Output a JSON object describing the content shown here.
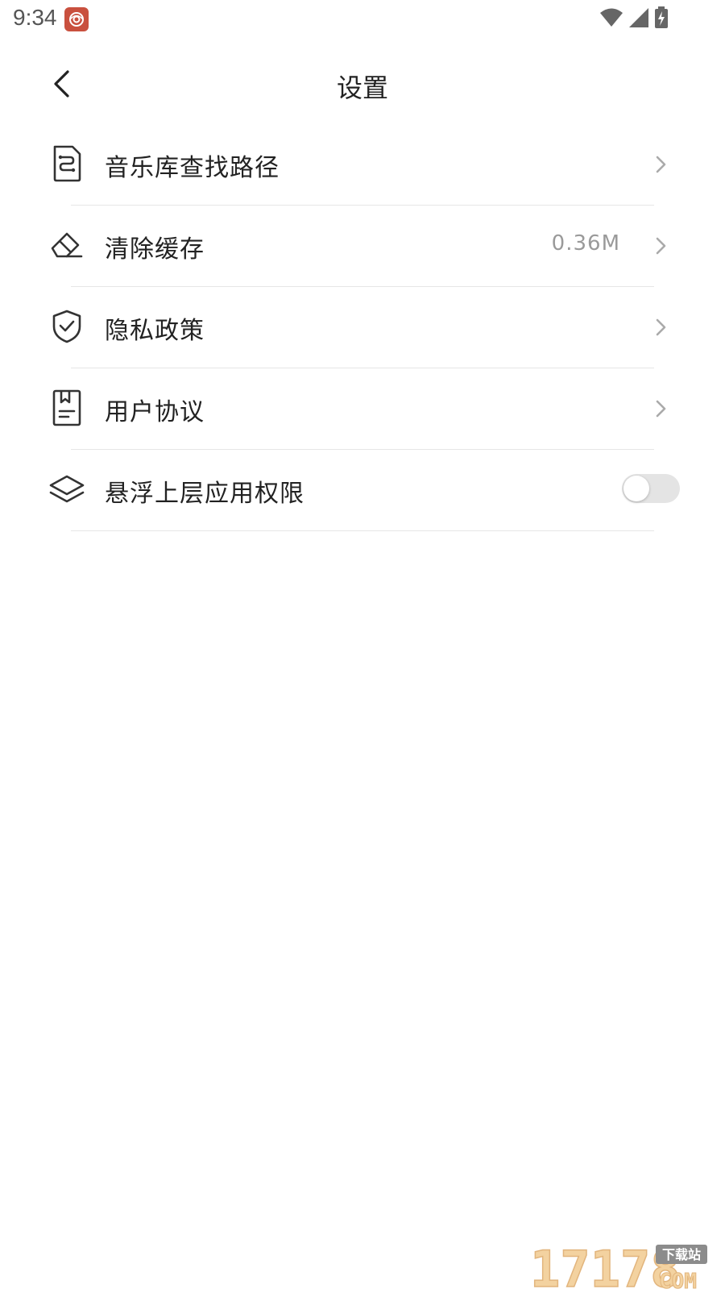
{
  "status_bar": {
    "time": "9:34"
  },
  "header": {
    "title": "设置"
  },
  "settings": [
    {
      "label": "音乐库查找路径",
      "icon": "document-path-icon"
    },
    {
      "label": "清除缓存",
      "icon": "eraser-icon",
      "value": "0.36M"
    },
    {
      "label": "隐私政策",
      "icon": "shield-check-icon"
    },
    {
      "label": "用户协议",
      "icon": "bookmark-document-icon"
    },
    {
      "label": "悬浮上层应用权限",
      "icon": "layers-icon",
      "toggle_on": false
    }
  ],
  "watermark": {
    "brand": "17178",
    "domain": "COM",
    "tag": "下载站"
  },
  "colors": {
    "divider": "#e6e6e6",
    "secondary_text": "#9a9a9a",
    "toggle_off": "#e4e4e4",
    "status_app_icon": "#c9503e"
  }
}
